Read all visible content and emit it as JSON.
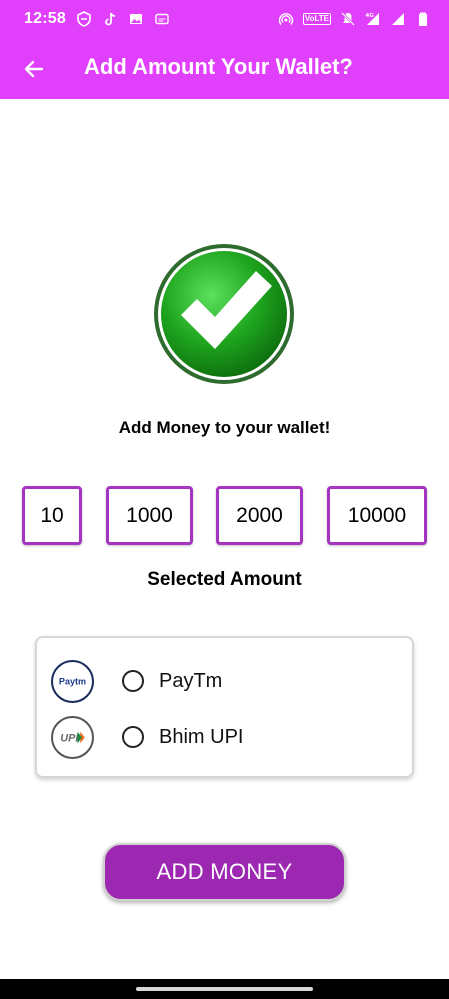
{
  "status_bar": {
    "time": "12:58",
    "network_badge": "VoLTE",
    "network_type": "4G"
  },
  "toolbar": {
    "title": "Add Amount Your Wallet?"
  },
  "main": {
    "headline": "Add Money to your wallet!",
    "amounts": [
      "10",
      "1000",
      "2000",
      "10000"
    ],
    "selected_label": "Selected Amount",
    "payment_methods": [
      {
        "label": "PayTm",
        "logo_text": "Paytm",
        "icon": "paytm-logo"
      },
      {
        "label": "Bhim UPI",
        "logo_text": "UPI",
        "icon": "upi-logo"
      }
    ],
    "add_button_label": "ADD MONEY"
  },
  "colors": {
    "app_bar": "#e040fb",
    "accent_border": "#a535c0",
    "button": "#9c27b0",
    "success_green": "#1ea51e"
  }
}
